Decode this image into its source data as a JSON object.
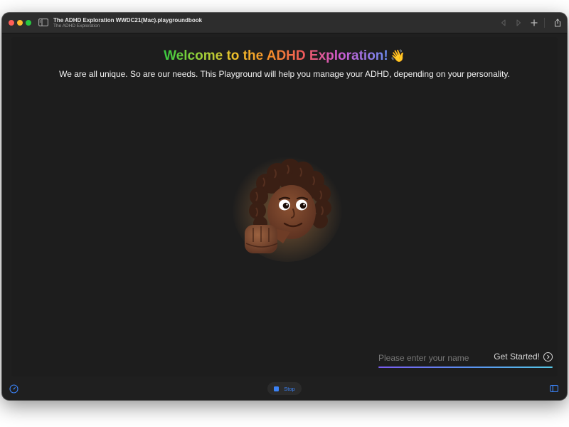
{
  "window": {
    "title": "The ADHD Exploration WWDC21(Mac).playgroundbook",
    "subtitle": "The ADHD Exploration",
    "toolbar_icons": [
      "sidebar-toggle-icon",
      "back-icon",
      "forward-icon",
      "add-icon",
      "share-icon"
    ]
  },
  "content": {
    "welcome_title": "Welcome to the ADHD Exploration!",
    "welcome_emoji": "👋",
    "subtitle": "We are all unique. So are our needs. This Playground will help you manage your ADHD, depending on your personality.",
    "name_input": {
      "placeholder": "Please enter your name",
      "value": ""
    },
    "get_started_label": "Get Started!"
  },
  "bottom_bar": {
    "stop_label": "Stop",
    "icons": [
      "speed-gauge-icon",
      "stop-icon",
      "panel-toggle-icon"
    ]
  },
  "colors": {
    "accent": "#3b82f6",
    "background": "#1f1f1f",
    "title_gradient": [
      "#37c93f",
      "#f1c02a",
      "#ef5a5a",
      "#d25ad2",
      "#6a8cf0"
    ],
    "underline_gradient": [
      "#7a5cf0",
      "#55c6e6"
    ]
  }
}
